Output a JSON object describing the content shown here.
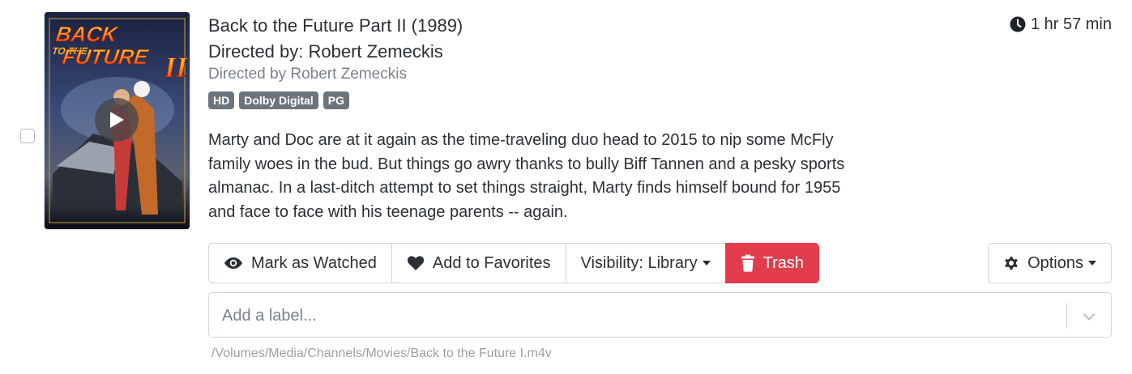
{
  "item": {
    "title": "Back to the Future Part II (1989)",
    "director_line": "Directed by: Robert Zemeckis",
    "subtext": "Directed by Robert Zemeckis",
    "runtime": "1 hr 57 min",
    "badges": [
      "HD",
      "Dolby Digital",
      "PG"
    ],
    "summary": "Marty and Doc are at it again as the time-traveling duo head to 2015 to nip some McFly family woes in the bud. But things go awry thanks to bully Biff Tannen and a pesky sports almanac. In a last-ditch attempt to set things straight, Marty finds himself bound for 1955 and face to face with his teenage parents -- again.",
    "file_path": "/Volumes/Media/Channels/Movies/Back to the Future I.m4v"
  },
  "poster": {
    "title_line1": "BACK",
    "title_line2": "TO THE",
    "title_line3": "FUTURE",
    "title_line4": "II"
  },
  "actions": {
    "mark_watched": "Mark as Watched",
    "add_favorites": "Add to Favorites",
    "visibility": "Visibility: Library",
    "trash": "Trash",
    "options": "Options"
  },
  "label_input": {
    "placeholder": "Add a label..."
  },
  "colors": {
    "danger": "#e23c4d",
    "badge": "#6c757d",
    "border": "#ced4da"
  },
  "icons": {
    "runtime": "clock-icon",
    "watched": "eye-icon",
    "favorite": "heart-icon",
    "trash": "trash-icon",
    "options": "gear-icon",
    "play": "play-icon",
    "dropdown": "chevron-down-icon"
  }
}
